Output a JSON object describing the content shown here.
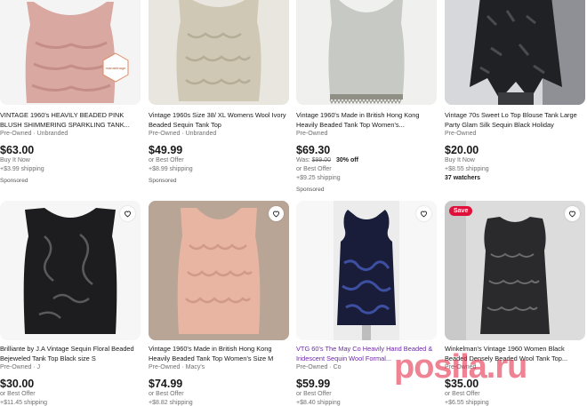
{
  "watermark": "posila.ru",
  "save_badge": "Save",
  "listings": [
    {
      "title": "VINTAGE 1960's HEAVILY BEADED PINK BLUSH SHIMMERING SPARKLING TANK...",
      "condition": "Pre-Owned · Unbranded",
      "price": "$63.00",
      "line1": "Buy It Now",
      "line2": "+$3.99 shipping",
      "sponsored": "Sponsored",
      "seal_text": "manaklinage",
      "colors": {
        "bg": "#f4f4f4",
        "garment": "#d9a8a0",
        "accent": "#c48e86"
      }
    },
    {
      "title": "Vintage 1960s Size 38/ XL Womens Wool Ivory Beaded Sequin Tank Top",
      "condition": "Pre-Owned · Unbranded",
      "price": "$49.99",
      "line1": "or Best Offer",
      "line2": "+$8.99 shipping",
      "sponsored": "Sponsored",
      "colors": {
        "bg": "#e9e6df",
        "garment": "#cfc8b4",
        "accent": "#b5ad96"
      }
    },
    {
      "title": "Vintage 1960's Made in British Hong Kong Heavily Beaded Tank Top Women's...",
      "condition": "Pre-Owned",
      "price": "$69.30",
      "was_label": "Was:",
      "was_price": "$99.00",
      "discount": "30% off",
      "line1": "or Best Offer",
      "line2": "+$9.25 shipping",
      "sponsored": "Sponsored",
      "colors": {
        "bg": "#f0f0ee",
        "garment": "#c7c9c4",
        "accent": "#8f8f86"
      }
    },
    {
      "title": "Vintage 70s Sweet Lo Top Blouse Tank Large Party Glam Silk Sequin Black Holiday",
      "condition": "Pre-Owned",
      "price": "$20.00",
      "line1": "Buy It Now",
      "line2": "+$8.55 shipping",
      "watchers": "37 watchers",
      "colors": {
        "bg": "#d6d8dc",
        "garment": "#202124",
        "accent": "#4a4b50"
      }
    },
    {
      "title": "Brilliante by J.A Vintage Sequin Floral Beaded Bejeweled Tank Top Black size S",
      "condition": "Pre-Owned · J",
      "price": "$30.00",
      "line1": "or Best Offer",
      "line2": "+$11.45 shipping",
      "colors": {
        "bg": "#f6f6f6",
        "garment": "#1d1d1f",
        "accent": "#5a5a5e"
      }
    },
    {
      "title": "Vintage 1960's Made in British Hong Kong Heavily Beaded Tank Top Women's Size M",
      "condition": "Pre-Owned · Macy's",
      "price": "$74.99",
      "line1": "or Best Offer",
      "line2": "+$8.82 shipping",
      "colors": {
        "bg": "#b9a596",
        "garment": "#e8b5a3",
        "accent": "#d19a88"
      }
    },
    {
      "title": "VTG 60's The May Co Heavily Hand Beaded & Iridescent Sequin Wool Formal...",
      "condition": "Pre-Owned · Co",
      "price": "$59.99",
      "line1": "or Best Offer",
      "line2": "+$8.40 shipping",
      "colors": {
        "bg": "#f7f7f7",
        "garment": "#1a1d3a",
        "accent": "#3c4fa0"
      }
    },
    {
      "title": "Winkelman's Vintage 1960 Women Black Beaded Densely Beaded Wool Tank Top...",
      "condition": "Pre-Owned",
      "price": "$35.00",
      "line1": "or Best Offer",
      "line2": "+$6.55 shipping",
      "colors": {
        "bg": "#dcdcdc",
        "garment": "#2a2a2d",
        "accent": "#6b6b70"
      }
    }
  ]
}
